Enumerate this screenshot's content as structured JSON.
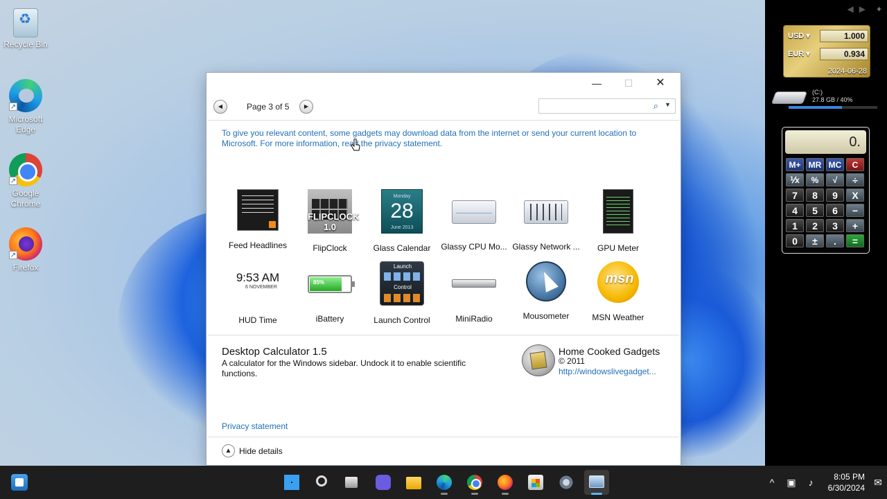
{
  "desktop": {
    "icons": [
      {
        "label": "Recycle Bin",
        "icon": "recycle-bin-icon"
      },
      {
        "label": "Microsoft Edge",
        "icon": "edge-icon"
      },
      {
        "label": "Google Chrome",
        "icon": "chrome-icon"
      },
      {
        "label": "Firefox",
        "icon": "firefox-icon"
      }
    ]
  },
  "sidebar": {
    "nav": {
      "prev": "◀",
      "next": "▶",
      "add": "+"
    },
    "currency": {
      "rows": [
        {
          "code": "USD",
          "value": "1.000"
        },
        {
          "code": "EUR",
          "value": "0.934"
        }
      ],
      "date": "2024-06-28"
    },
    "drive": {
      "label": "(C:)",
      "info": "27.8 GB / 40%",
      "used_fraction": 0.6
    },
    "calculator": {
      "display": "0.",
      "keys": [
        "M+",
        "MR",
        "MC",
        "C",
        "⅟x",
        "%",
        "√",
        "÷",
        "7",
        "8",
        "9",
        "X",
        "4",
        "5",
        "6",
        "−",
        "1",
        "2",
        "3",
        "+",
        "0",
        "±",
        ".",
        "="
      ]
    }
  },
  "dialog": {
    "controls": {
      "minimize": "—",
      "maximize": "☐",
      "close": "✕"
    },
    "nav": {
      "prev": "◀",
      "next": "▶",
      "page_label": "Page 3 of 5"
    },
    "search": {
      "placeholder": "",
      "value": ""
    },
    "notice": "To give you relevant content, some gadgets may download data from the internet or send your current location to Microsoft. For more information, read the privacy statement.",
    "gadgets": [
      {
        "label": "Feed Headlines",
        "icon": "feed-headlines-icon"
      },
      {
        "label": "FlipClock",
        "icon": "flipclock-icon",
        "thumb_text": "FLIPCLOCK 1.0"
      },
      {
        "label": "Glass Calendar",
        "icon": "glass-calendar-icon",
        "thumb_day": "28",
        "thumb_top": "Monday",
        "thumb_bottom": "June 2013"
      },
      {
        "label": "Glassy CPU Mo...",
        "icon": "glassy-cpu-monitor-icon"
      },
      {
        "label": "Glassy Network ...",
        "icon": "glassy-network-icon"
      },
      {
        "label": "GPU Meter",
        "icon": "gpu-meter-icon"
      },
      {
        "label": "HUD Time",
        "icon": "hud-time-icon",
        "thumb_time": "9:53 AM",
        "thumb_date": "6 NOVEMBER"
      },
      {
        "label": "iBattery",
        "icon": "ibattery-icon",
        "thumb_pct": "85%",
        "level": 0.85
      },
      {
        "label": "Launch Control",
        "icon": "launch-control-icon",
        "thumb_top": "Launch",
        "thumb_mid": "Control"
      },
      {
        "label": "MiniRadio",
        "icon": "miniradio-icon"
      },
      {
        "label": "Mousometer",
        "icon": "mousometer-icon"
      },
      {
        "label": "MSN Weather",
        "icon": "msn-weather-icon",
        "thumb_text": "msn"
      }
    ],
    "details": {
      "title": "Desktop Calculator 1.5",
      "description": "A calculator for the Windows sidebar. Undock it to enable scientific functions.",
      "publisher": "Home Cooked Gadgets",
      "copyright": "© 2011",
      "link": "http://windowslivegadget..."
    },
    "privacy_link": "Privacy statement",
    "hide_details": "Hide details"
  },
  "taskbar": {
    "apps": [
      "start",
      "search",
      "task-view",
      "chat",
      "file-explorer",
      "edge",
      "chrome",
      "firefox",
      "store",
      "settings",
      "gadgets"
    ],
    "tray": {
      "chevron": "^",
      "time": "8:05 PM",
      "date": "6/30/2024"
    }
  },
  "colors": {
    "link": "#1f6fb9",
    "taskbar": "#1e1e1e",
    "sidebar": "#000000",
    "accent": "#5fb2ff"
  }
}
